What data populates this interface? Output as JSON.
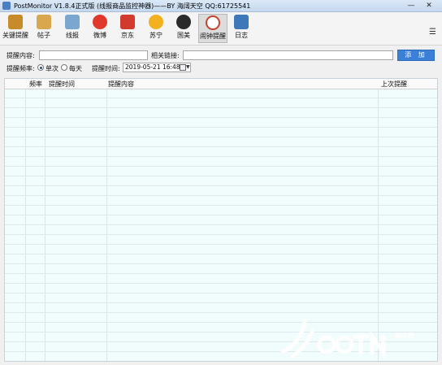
{
  "window": {
    "title": "PostMonitor V1.8.4正式版 (线报商品监控神器)——BY 海阔天空 QQ:61725541"
  },
  "toolbar": {
    "items": [
      {
        "label": "关键提醒",
        "icon": "clipboard-icon",
        "color": "#c78b2c"
      },
      {
        "label": "帖子",
        "icon": "notepad-icon",
        "color": "#d9a84e"
      },
      {
        "label": "线报",
        "icon": "document-icon",
        "color": "#7aa6cf"
      },
      {
        "label": "微博",
        "icon": "weibo-icon",
        "color": "#e0382a"
      },
      {
        "label": "京东",
        "icon": "jd-icon",
        "color": "#d23a2e"
      },
      {
        "label": "苏宁",
        "icon": "suning-icon",
        "color": "#f3b01f"
      },
      {
        "label": "国美",
        "icon": "gome-icon",
        "color": "#2b2b2b"
      },
      {
        "label": "闹钟提醒",
        "icon": "alarm-clock-icon",
        "color": "#c2432e"
      },
      {
        "label": "日志",
        "icon": "log-icon",
        "color": "#3f78b9"
      }
    ]
  },
  "form": {
    "content_label": "提醒内容:",
    "link_label": "相关链接:",
    "add_button": "添 加",
    "freq_label": "提醒频率:",
    "freq_once": "单次",
    "freq_daily": "每天",
    "time_label": "提醒时间:",
    "time_value": "2019-05-21 16:48"
  },
  "table": {
    "headers": [
      "频率",
      "提醒时间",
      "提醒内容",
      "上次提醒"
    ]
  },
  "watermark": {
    "text": "腾牛网"
  },
  "colors": {
    "accent": "#3b7fd6",
    "table_bg": "#f1fcfc"
  }
}
